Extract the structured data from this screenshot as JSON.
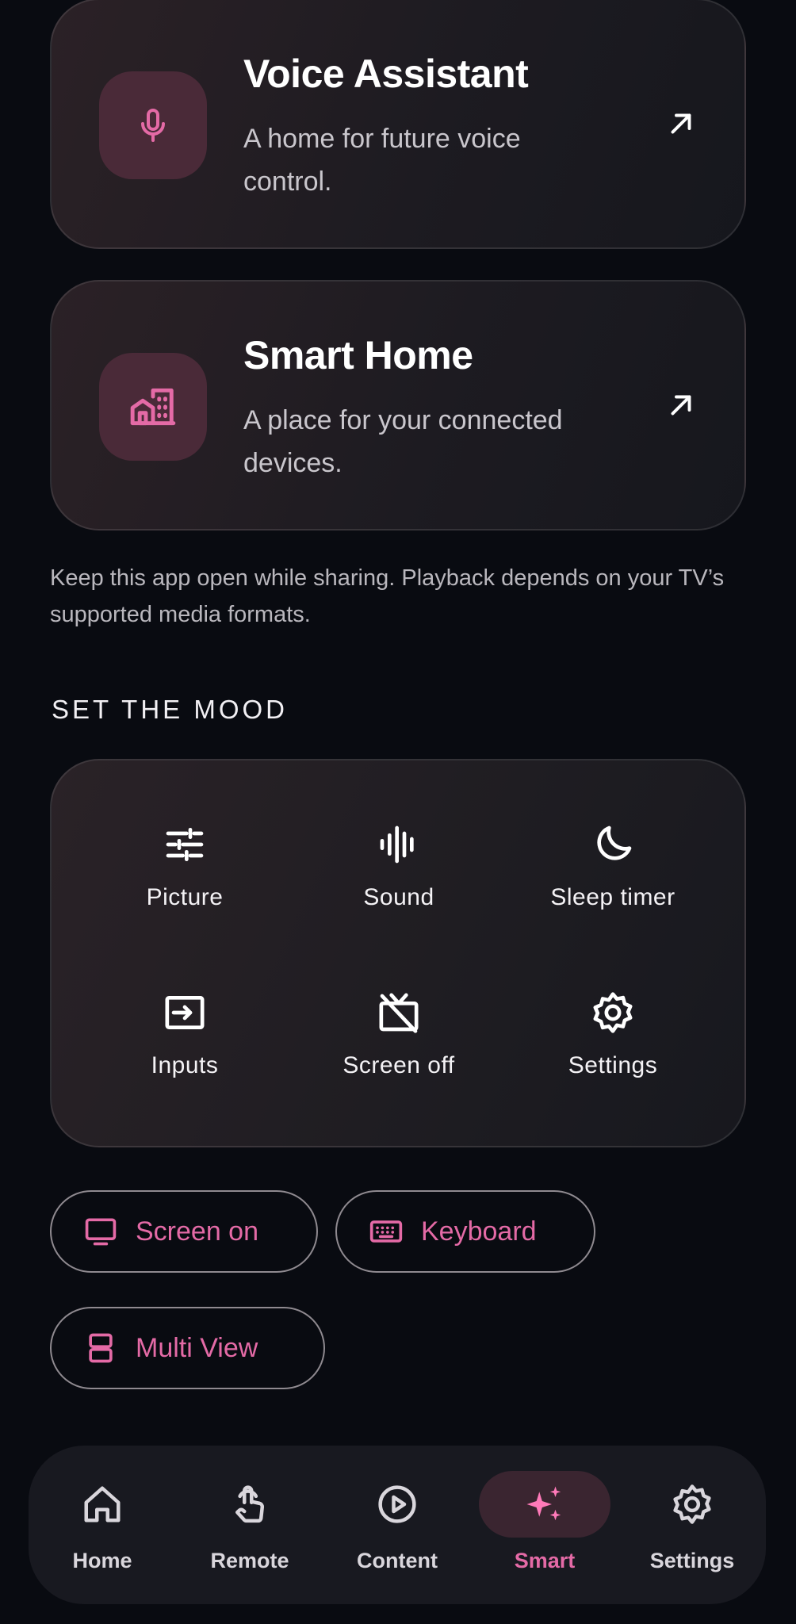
{
  "cards": [
    {
      "title": "Voice Assistant",
      "description": "A home for future voice control.",
      "icon": "microphone-icon"
    },
    {
      "title": "Smart Home",
      "description": "A place for your connected devices.",
      "icon": "smart-home-icon"
    }
  ],
  "info_text": "Keep this app open while sharing. Playback depends on your TV’s supported media formats.",
  "mood": {
    "title": "SET THE MOOD",
    "items": [
      {
        "label": "Picture",
        "icon": "sliders-icon"
      },
      {
        "label": "Sound",
        "icon": "sound-wave-icon"
      },
      {
        "label": "Sleep timer",
        "icon": "moon-icon"
      },
      {
        "label": "Inputs",
        "icon": "input-icon"
      },
      {
        "label": "Screen off",
        "icon": "tv-off-icon"
      },
      {
        "label": "Settings",
        "icon": "gear-icon"
      }
    ]
  },
  "pills": [
    {
      "label": "Screen on",
      "icon": "monitor-icon"
    },
    {
      "label": "Keyboard",
      "icon": "keyboard-icon"
    },
    {
      "label": "Multi View",
      "icon": "split-view-icon"
    }
  ],
  "nav": {
    "items": [
      {
        "label": "Home",
        "icon": "home-icon"
      },
      {
        "label": "Remote",
        "icon": "touch-icon"
      },
      {
        "label": "Content",
        "icon": "play-circle-icon"
      },
      {
        "label": "Smart",
        "icon": "sparkles-icon"
      },
      {
        "label": "Settings",
        "icon": "gear-icon"
      }
    ],
    "active": "Smart"
  },
  "colors": {
    "background": "#090b11",
    "accent": "#e46aa6",
    "card_icon_bg": "#4a2a38",
    "nav_bg": "#181920"
  }
}
